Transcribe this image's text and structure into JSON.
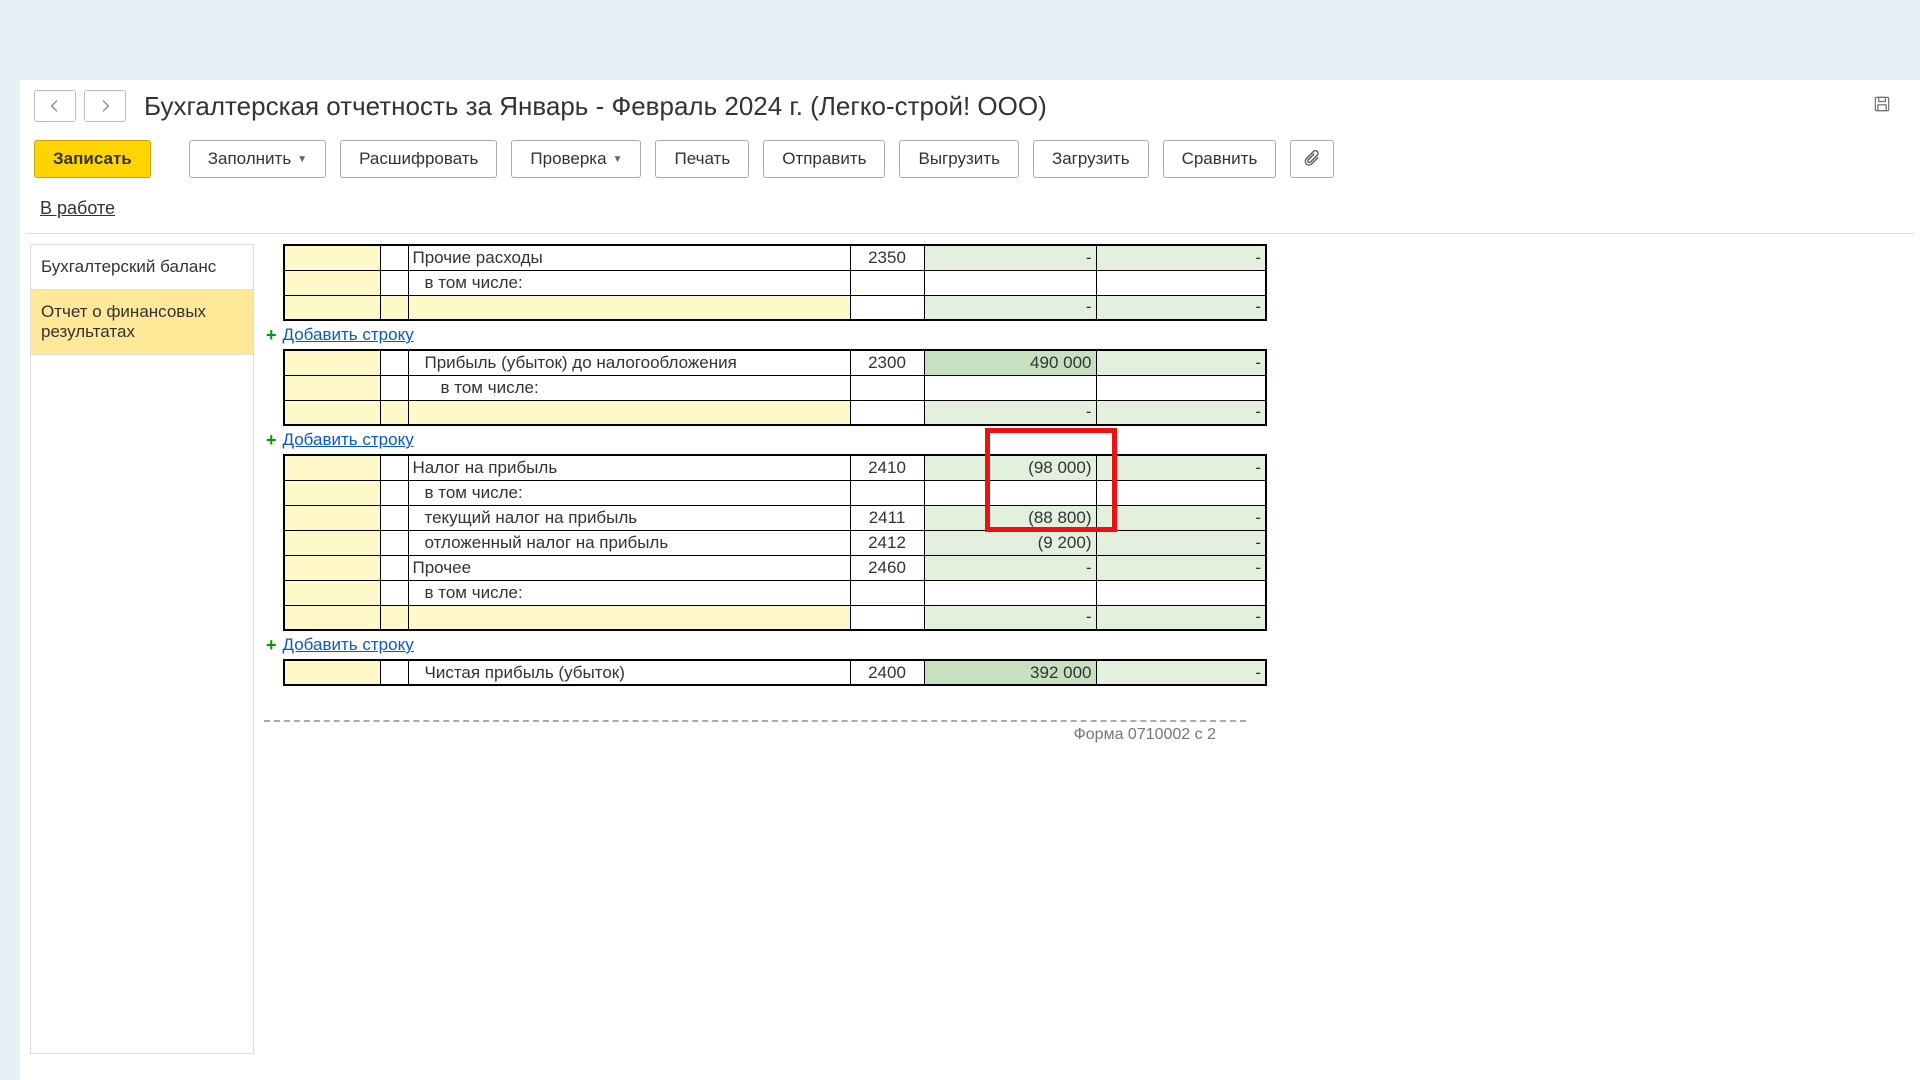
{
  "title": "Бухгалтерская отчетность за Январь - Февраль 2024 г. (Легко-строй! ООО)",
  "buttons": {
    "save": "Записать",
    "fill": "Заполнить",
    "decode": "Расшифровать",
    "check": "Проверка",
    "print": "Печать",
    "send": "Отправить",
    "export": "Выгрузить",
    "import": "Загрузить",
    "compare": "Сравнить"
  },
  "status": "В работе",
  "sidebar": {
    "items": [
      {
        "label": "Бухгалтерский баланс"
      },
      {
        "label": "Отчет о финансовых результатах"
      }
    ],
    "active": 1
  },
  "add_row": "Добавить строку",
  "footer_text": "Форма 0710002 с 2",
  "rows": [
    {
      "label": "Прочие расходы",
      "indent": 0,
      "code": "2350",
      "v1": "-",
      "v2": "-",
      "v1bg": "bg-green-light",
      "v2bg": "bg-green-light",
      "top": true
    },
    {
      "label": "в том числе:",
      "indent": 1,
      "code": "",
      "v1": "",
      "v2": "",
      "v1bg": "",
      "v2bg": ""
    },
    {
      "label": "",
      "indent": 0,
      "code": "",
      "v1": "-",
      "v2": "-",
      "yellowline": true,
      "v1bg": "bg-green-light",
      "v2bg": "bg-green-light",
      "bottom": true
    }
  ],
  "group2": [
    {
      "label": "Прибыль (убыток) до налогообложения",
      "indent": 1,
      "code": "2300",
      "v1": "490 000",
      "v2": "-",
      "v1bg": "bg-green-dark",
      "v2bg": "bg-green-light",
      "top": true
    },
    {
      "label": "в том числе:",
      "indent": 2,
      "code": "",
      "v1": "",
      "v2": "",
      "v1bg": "",
      "v2bg": ""
    },
    {
      "label": "",
      "indent": 0,
      "code": "",
      "v1": "-",
      "v2": "-",
      "yellowline": true,
      "v1bg": "bg-green-light",
      "v2bg": "bg-green-light",
      "bottom": true
    }
  ],
  "group3": [
    {
      "label": "Налог на прибыль",
      "indent": 0,
      "code": "2410",
      "v1": "(98 000)",
      "v2": "-",
      "v1bg": "bg-green-light",
      "v2bg": "bg-green-light",
      "top": true
    },
    {
      "label": "в том числе:",
      "indent": 1,
      "code": "",
      "v1": "",
      "v2": "",
      "v1bg": "",
      "v2bg": ""
    },
    {
      "label": "текущий налог на прибыль",
      "indent": 1,
      "code": "2411",
      "v1": "(88 800)",
      "v2": "-",
      "v1bg": "bg-green-light",
      "v2bg": "bg-green-light"
    },
    {
      "label": "отложенный налог на прибыль",
      "indent": 1,
      "code": "2412",
      "v1": "(9 200)",
      "v2": "-",
      "v1bg": "bg-green-light",
      "v2bg": "bg-green-light"
    },
    {
      "label": "Прочее",
      "indent": 0,
      "code": "2460",
      "v1": "-",
      "v2": "-",
      "v1bg": "bg-green-light",
      "v2bg": "bg-green-light"
    },
    {
      "label": "в том числе:",
      "indent": 1,
      "code": "",
      "v1": "",
      "v2": "",
      "v1bg": "",
      "v2bg": ""
    },
    {
      "label": "",
      "indent": 0,
      "code": "",
      "v1": "-",
      "v2": "-",
      "yellowline": true,
      "v1bg": "bg-green-light",
      "v2bg": "bg-green-light",
      "bottom": true
    }
  ],
  "group4": [
    {
      "label": "Чистая прибыль (убыток)",
      "indent": 1,
      "code": "2400",
      "v1": "392 000",
      "v2": "-",
      "v1bg": "bg-green-dark",
      "v2bg": "bg-green-light",
      "top": true,
      "bottom": true
    }
  ]
}
